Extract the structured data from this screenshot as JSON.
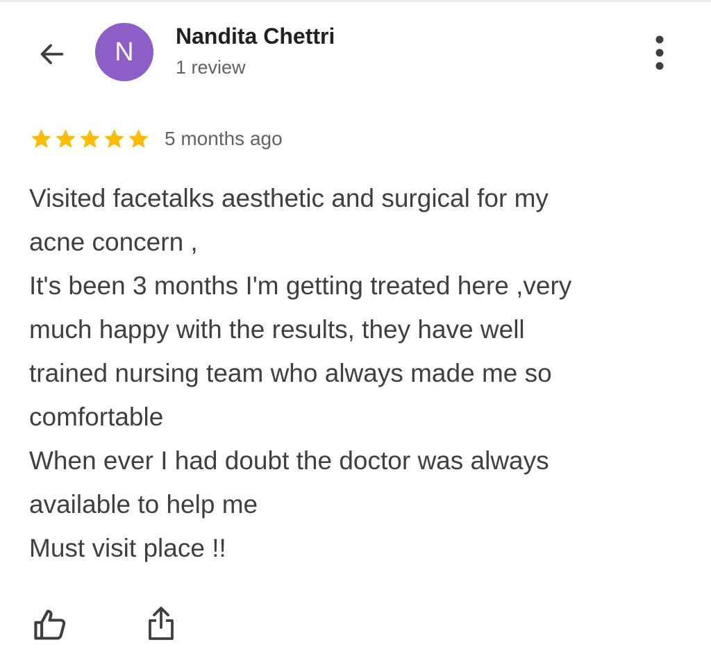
{
  "header": {
    "back_icon": "arrow-left-icon",
    "avatar_initial": "N",
    "avatar_color": "#8e5ec8",
    "reviewer_name": "Nandita Chettri",
    "review_count": "1 review",
    "more_icon": "more-vertical-icon"
  },
  "review": {
    "rating": 5,
    "rating_max": 5,
    "star_color": "#fbbc04",
    "date": "5 months ago",
    "lines": [
      "Visited facetalks aesthetic and surgical for my",
      "acne concern ,",
      "It's been 3 months I'm getting treated here ,very",
      "much happy with the results, they have well",
      "trained nursing team who always made me so",
      "comfortable",
      "When ever I had doubt the doctor was always",
      "available to help me",
      "Must visit place !!"
    ]
  },
  "actions": {
    "like_icon": "thumbs-up-icon",
    "share_icon": "share-icon"
  }
}
